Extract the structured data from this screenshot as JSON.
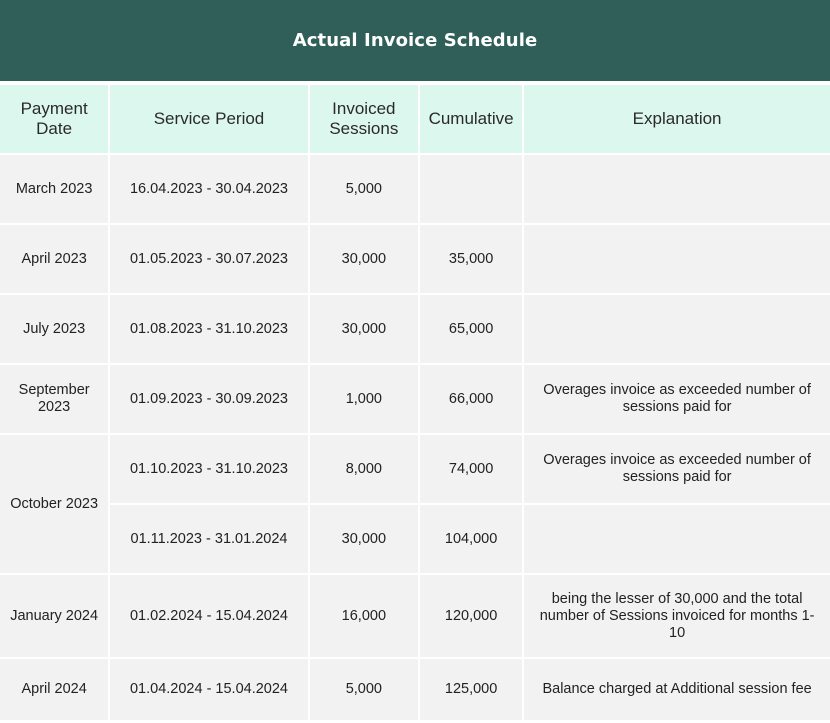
{
  "title": "Actual Invoice Schedule",
  "headers": {
    "payment_date": "Payment Date",
    "service_period": "Service Period",
    "invoiced_sessions": "Invoiced Sessions",
    "cumulative": "Cumulative",
    "explanation": "Explanation"
  },
  "rows": [
    {
      "payment_date": "March 2023",
      "service_period": "16.04.2023 - 30.04.2023",
      "invoiced_sessions": "5,000",
      "cumulative": "",
      "explanation": ""
    },
    {
      "payment_date": "April 2023",
      "service_period": "01.05.2023 - 30.07.2023",
      "invoiced_sessions": "30,000",
      "cumulative": "35,000",
      "explanation": ""
    },
    {
      "payment_date": "July 2023",
      "service_period": "01.08.2023 - 31.10.2023",
      "invoiced_sessions": "30,000",
      "cumulative": "65,000",
      "explanation": ""
    },
    {
      "payment_date": "September 2023",
      "service_period": "01.09.2023 - 30.09.2023",
      "invoiced_sessions": "1,000",
      "cumulative": "66,000",
      "explanation": "Overages invoice as exceeded number of sessions paid for"
    },
    {
      "payment_date": "October 2023",
      "service_period": "01.10.2023 - 31.10.2023",
      "invoiced_sessions": "8,000",
      "cumulative": "74,000",
      "explanation": "Overages invoice as exceeded number of sessions paid for"
    },
    {
      "payment_date": "",
      "service_period": "01.11.2023 - 31.01.2024",
      "invoiced_sessions": "30,000",
      "cumulative": "104,000",
      "explanation": ""
    },
    {
      "payment_date": "January 2024",
      "service_period": "01.02.2024 - 15.04.2024",
      "invoiced_sessions": "16,000",
      "cumulative": "120,000",
      "explanation": "being the lesser of 30,000 and the total number of Sessions invoiced for months 1-10"
    },
    {
      "payment_date": "April 2024",
      "service_period": "01.04.2024 - 15.04.2024",
      "invoiced_sessions": "5,000",
      "cumulative": "125,000",
      "explanation": "Balance charged at Additional session fee"
    }
  ],
  "colors": {
    "banner": "#2f5f58",
    "header_cell": "#dcf7ee",
    "body_cell": "#f2f2f2"
  }
}
